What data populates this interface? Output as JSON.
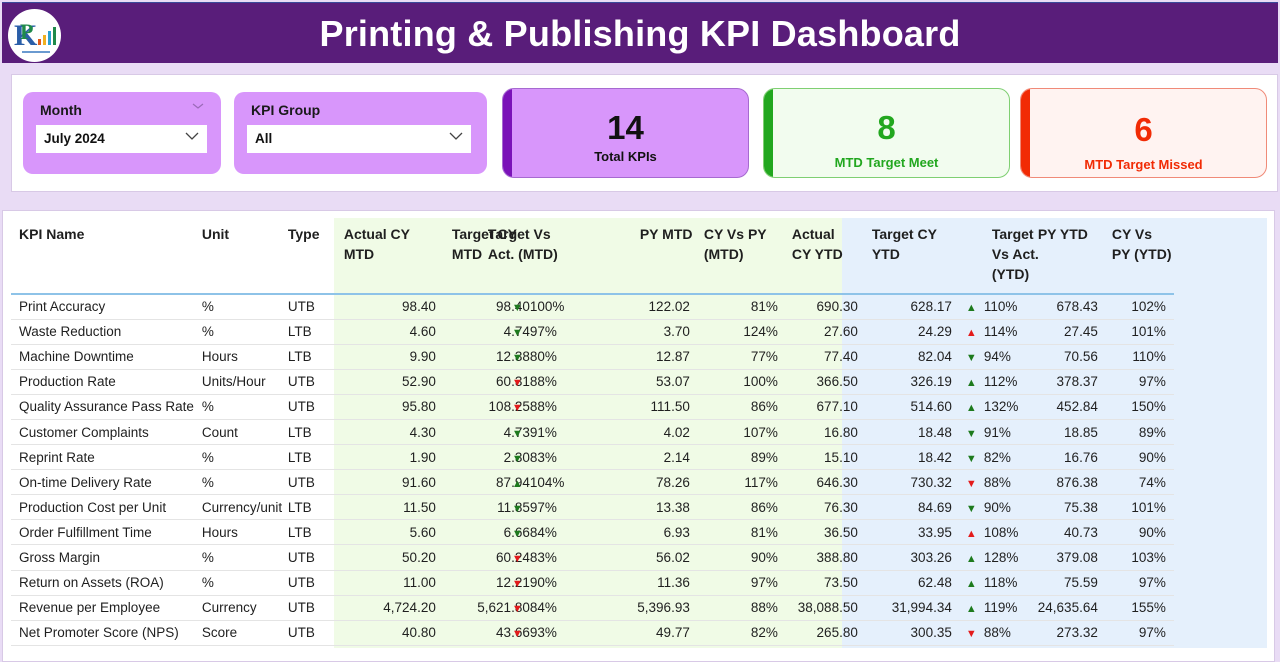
{
  "header": {
    "title": "Printing & Publishing KPI Dashboard",
    "logo_icon": "company-logo-icon"
  },
  "filters": {
    "month": {
      "label": "Month",
      "value": "July 2024"
    },
    "kpi_group": {
      "label": "KPI Group",
      "value": "All"
    }
  },
  "cards": {
    "total": {
      "value": "14",
      "caption": "Total KPIs",
      "color": "#7a12b8"
    },
    "meet": {
      "value": "8",
      "caption": "MTD Target Meet",
      "color": "#22a71f"
    },
    "missed": {
      "value": "6",
      "caption": "MTD Target Missed",
      "color": "#f12b05"
    }
  },
  "colors": {
    "header_bg": "#591d7a",
    "slicer_bg": "#d896fb",
    "mtd_zone": "#f0fbe6",
    "ytd_zone": "#e5f0fc",
    "good": "#1d7a1d",
    "bad": "#e31b1b"
  },
  "table": {
    "headers": {
      "kpi_name": "KPI Name",
      "unit": "Unit",
      "type": "Type",
      "actual_cy_mtd": "Actual CY MTD",
      "target_cy_mtd": "Target CY MTD",
      "target_vs_act_mtd": "Target Vs Act. (MTD)",
      "py_mtd": "PY MTD",
      "cy_vs_py_mtd": "CY Vs PY (MTD)",
      "actual_cy_ytd": "Actual CY YTD",
      "target_cy_ytd": "Target CY YTD",
      "target_vs_act_ytd": "Target Vs Act. (YTD)",
      "py_ytd": "PY YTD",
      "cy_vs_py_ytd": "CY Vs PY (YTD)"
    },
    "rows": [
      {
        "name": "Print Accuracy",
        "unit": "%",
        "type": "UTB",
        "act_mtd": "98.40",
        "tgt_mtd": "98.40",
        "mtd_icon": "down-green",
        "mtd_pct": "100%",
        "py_mtd": "122.02",
        "cy_py_mtd": "81%",
        "act_ytd": "690.30",
        "tgt_ytd": "628.17",
        "ytd_icon": "up-green",
        "ytd_pct": "110%",
        "py_ytd": "678.43",
        "cy_py_ytd": "102%"
      },
      {
        "name": "Waste Reduction",
        "unit": "%",
        "type": "LTB",
        "act_mtd": "4.60",
        "tgt_mtd": "4.74",
        "mtd_icon": "down-green",
        "mtd_pct": "97%",
        "py_mtd": "3.70",
        "cy_py_mtd": "124%",
        "act_ytd": "27.60",
        "tgt_ytd": "24.29",
        "ytd_icon": "up-red",
        "ytd_pct": "114%",
        "py_ytd": "27.45",
        "cy_py_ytd": "101%"
      },
      {
        "name": "Machine Downtime",
        "unit": "Hours",
        "type": "LTB",
        "act_mtd": "9.90",
        "tgt_mtd": "12.38",
        "mtd_icon": "down-green",
        "mtd_pct": "80%",
        "py_mtd": "12.87",
        "cy_py_mtd": "77%",
        "act_ytd": "77.40",
        "tgt_ytd": "82.04",
        "ytd_icon": "down-green",
        "ytd_pct": "94%",
        "py_ytd": "70.56",
        "cy_py_ytd": "110%"
      },
      {
        "name": "Production Rate",
        "unit": "Units/Hour",
        "type": "UTB",
        "act_mtd": "52.90",
        "tgt_mtd": "60.31",
        "mtd_icon": "down-red",
        "mtd_pct": "88%",
        "py_mtd": "53.07",
        "cy_py_mtd": "100%",
        "act_ytd": "366.50",
        "tgt_ytd": "326.19",
        "ytd_icon": "up-green",
        "ytd_pct": "112%",
        "py_ytd": "378.37",
        "cy_py_ytd": "97%"
      },
      {
        "name": "Quality Assurance Pass Rate",
        "unit": "%",
        "type": "UTB",
        "act_mtd": "95.80",
        "tgt_mtd": "108.25",
        "mtd_icon": "down-red",
        "mtd_pct": "88%",
        "py_mtd": "111.50",
        "cy_py_mtd": "86%",
        "act_ytd": "677.10",
        "tgt_ytd": "514.60",
        "ytd_icon": "up-green",
        "ytd_pct": "132%",
        "py_ytd": "452.84",
        "cy_py_ytd": "150%"
      },
      {
        "name": "Customer Complaints",
        "unit": "Count",
        "type": "LTB",
        "act_mtd": "4.30",
        "tgt_mtd": "4.73",
        "mtd_icon": "down-green",
        "mtd_pct": "91%",
        "py_mtd": "4.02",
        "cy_py_mtd": "107%",
        "act_ytd": "16.80",
        "tgt_ytd": "18.48",
        "ytd_icon": "down-green",
        "ytd_pct": "91%",
        "py_ytd": "18.85",
        "cy_py_ytd": "89%"
      },
      {
        "name": "Reprint Rate",
        "unit": "%",
        "type": "LTB",
        "act_mtd": "1.90",
        "tgt_mtd": "2.30",
        "mtd_icon": "down-green",
        "mtd_pct": "83%",
        "py_mtd": "2.14",
        "cy_py_mtd": "89%",
        "act_ytd": "15.10",
        "tgt_ytd": "18.42",
        "ytd_icon": "down-green",
        "ytd_pct": "82%",
        "py_ytd": "16.76",
        "cy_py_ytd": "90%"
      },
      {
        "name": "On-time Delivery Rate",
        "unit": "%",
        "type": "UTB",
        "act_mtd": "91.60",
        "tgt_mtd": "87.94",
        "mtd_icon": "up-green",
        "mtd_pct": "104%",
        "py_mtd": "78.26",
        "cy_py_mtd": "117%",
        "act_ytd": "646.30",
        "tgt_ytd": "730.32",
        "ytd_icon": "down-red",
        "ytd_pct": "88%",
        "py_ytd": "876.38",
        "cy_py_ytd": "74%"
      },
      {
        "name": "Production Cost per Unit",
        "unit": "Currency/unit",
        "type": "LTB",
        "act_mtd": "11.50",
        "tgt_mtd": "11.85",
        "mtd_icon": "down-green",
        "mtd_pct": "97%",
        "py_mtd": "13.38",
        "cy_py_mtd": "86%",
        "act_ytd": "76.30",
        "tgt_ytd": "84.69",
        "ytd_icon": "down-green",
        "ytd_pct": "90%",
        "py_ytd": "75.38",
        "cy_py_ytd": "101%"
      },
      {
        "name": "Order Fulfillment Time",
        "unit": "Hours",
        "type": "LTB",
        "act_mtd": "5.60",
        "tgt_mtd": "6.66",
        "mtd_icon": "down-green",
        "mtd_pct": "84%",
        "py_mtd": "6.93",
        "cy_py_mtd": "81%",
        "act_ytd": "36.50",
        "tgt_ytd": "33.95",
        "ytd_icon": "up-red",
        "ytd_pct": "108%",
        "py_ytd": "40.73",
        "cy_py_ytd": "90%"
      },
      {
        "name": "Gross Margin",
        "unit": "%",
        "type": "UTB",
        "act_mtd": "50.20",
        "tgt_mtd": "60.24",
        "mtd_icon": "down-red",
        "mtd_pct": "83%",
        "py_mtd": "56.02",
        "cy_py_mtd": "90%",
        "act_ytd": "388.80",
        "tgt_ytd": "303.26",
        "ytd_icon": "up-green",
        "ytd_pct": "128%",
        "py_ytd": "379.08",
        "cy_py_ytd": "103%"
      },
      {
        "name": "Return on Assets (ROA)",
        "unit": "%",
        "type": "UTB",
        "act_mtd": "11.00",
        "tgt_mtd": "12.21",
        "mtd_icon": "down-red",
        "mtd_pct": "90%",
        "py_mtd": "11.36",
        "cy_py_mtd": "97%",
        "act_ytd": "73.50",
        "tgt_ytd": "62.48",
        "ytd_icon": "up-green",
        "ytd_pct": "118%",
        "py_ytd": "75.59",
        "cy_py_ytd": "97%"
      },
      {
        "name": "Revenue per Employee",
        "unit": "Currency",
        "type": "UTB",
        "act_mtd": "4,724.20",
        "tgt_mtd": "5,621.80",
        "mtd_icon": "down-red",
        "mtd_pct": "84%",
        "py_mtd": "5,396.93",
        "cy_py_mtd": "88%",
        "act_ytd": "38,088.50",
        "tgt_ytd": "31,994.34",
        "ytd_icon": "up-green",
        "ytd_pct": "119%",
        "py_ytd": "24,635.64",
        "cy_py_ytd": "155%"
      },
      {
        "name": "Net Promoter Score (NPS)",
        "unit": "Score",
        "type": "UTB",
        "act_mtd": "40.80",
        "tgt_mtd": "43.66",
        "mtd_icon": "down-red",
        "mtd_pct": "93%",
        "py_mtd": "49.77",
        "cy_py_mtd": "82%",
        "act_ytd": "265.80",
        "tgt_ytd": "300.35",
        "ytd_icon": "down-red",
        "ytd_pct": "88%",
        "py_ytd": "273.32",
        "cy_py_ytd": "97%"
      }
    ]
  }
}
